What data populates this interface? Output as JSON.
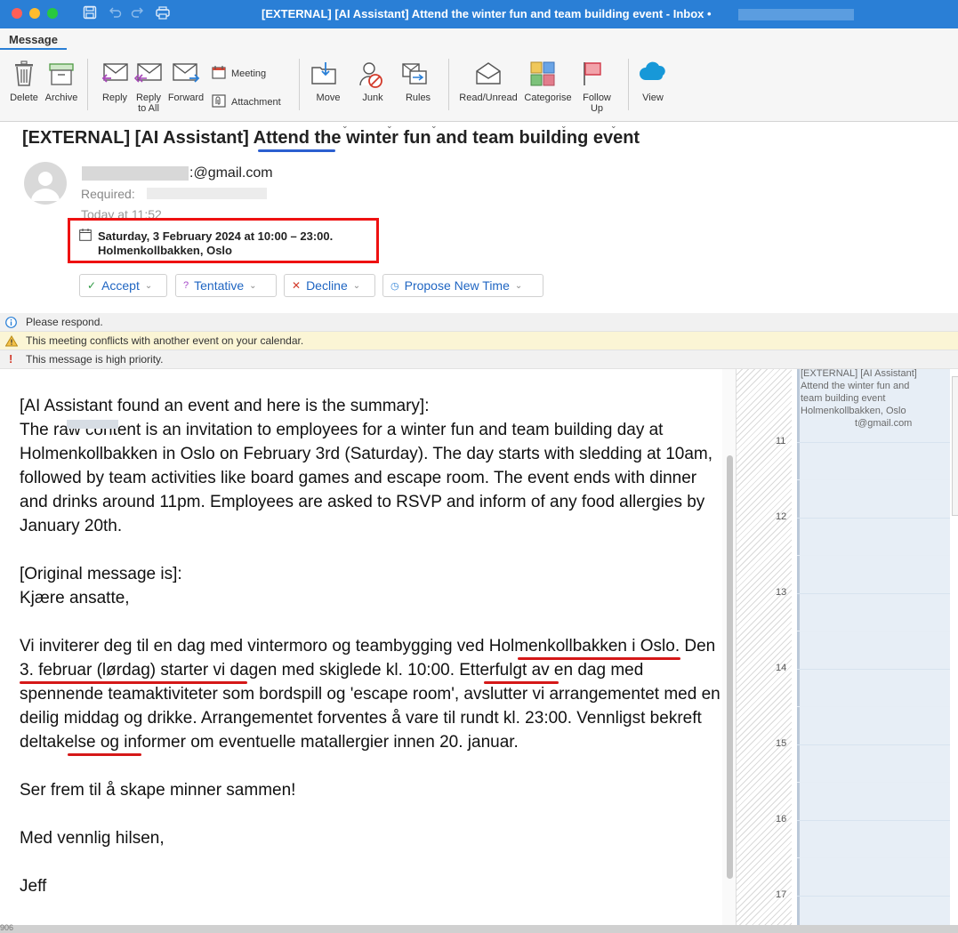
{
  "window": {
    "title": "[EXTERNAL] [AI Assistant] Attend the winter fun and team building event - Inbox •"
  },
  "tabs": {
    "message": "Message"
  },
  "ribbon": {
    "delete": "Delete",
    "archive": "Archive",
    "reply": "Reply",
    "reply_all": "Reply\nto All",
    "forward": "Forward",
    "meeting": "Meeting",
    "attachment": "Attachment",
    "move": "Move",
    "junk": "Junk",
    "rules": "Rules",
    "read_unread": "Read/Unread",
    "categorise": "Categorise",
    "follow_up": "Follow\nUp",
    "view": "View"
  },
  "email": {
    "subject": "[EXTERNAL] [AI Assistant] Attend the winter fun and team building event",
    "from_visible": ":@gmail.com",
    "required_label": "Required:",
    "date": "Today at 11:52",
    "event_line1": "Saturday, 3 February 2024 at 10:00 – 23:00.",
    "event_line2": "Holmenkollbakken, Oslo"
  },
  "responses": {
    "accept": "Accept",
    "tentative": "Tentative",
    "decline": "Decline",
    "propose": "Propose New Time"
  },
  "info_bars": {
    "respond": "Please respond.",
    "conflict": "This meeting conflicts with another event on your calendar.",
    "priority": "This message is high priority."
  },
  "body": {
    "summary_header": "[AI Assistant found an event and here is the summary]:",
    "summary": "The raw content is an invitation to employees for a winter fun and team building day at Holmenkollbakken in Oslo on February 3rd (Saturday). The day starts with sledding at 10am, followed by team activities like board games and escape room. The event ends with dinner and drinks around 11pm. Employees are asked to RSVP and inform of any food allergies by January 20th.",
    "original_header": "[Original message is]:",
    "greeting": "Kjære ansatte,",
    "p1_a": "Vi inviterer deg til en dag med vintermoro og teambygging ved ",
    "p1_b": "Holmenkollbakken i Oslo. Den 3. februar (lørdag)",
    "p1_c": " starter vi dagen med skiglede ",
    "p1_d": "kl. 10:00",
    "p1_e": ". Etterfulgt av en dag med spennende teamaktiviteter som bordspill og 'escape room', avslutter vi arrangementet med en deilig middag og drikke. Arrangementet forventes å vare til rundt ",
    "p1_f": "kl. 23:00",
    "p1_g": ". Vennligst bekreft deltakelse og informer om eventuelle matallergier innen 20. januar.",
    "closing1": "Ser frem til å skape minner sammen!",
    "closing2": "Med vennlig hilsen,",
    "signature": "Jeff"
  },
  "calendar": {
    "hours": [
      "11",
      "12",
      "13",
      "14",
      "15",
      "16",
      "17"
    ],
    "event_line1": "[EXTERNAL] [AI Assistant]",
    "event_line2": "Attend the winter fun and",
    "event_line3": "team building event",
    "event_line4": "Holmenkollbakken, Oslo",
    "event_line5": "t@gmail.com"
  },
  "footer": {
    "number": "906"
  },
  "colors": {
    "accent": "#2a7fd6",
    "highlight_red": "#e11111",
    "underline_blue": "#2b5fd0"
  }
}
